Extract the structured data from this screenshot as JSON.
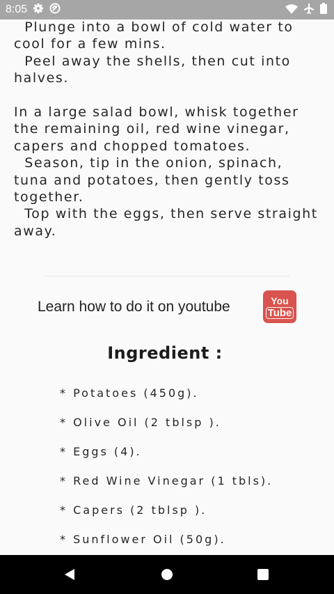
{
  "status_bar": {
    "time": "8:05",
    "icons_left": [
      "gear-icon",
      "sync-icon"
    ],
    "icons_right": [
      "wifi-icon",
      "airplane-icon",
      "battery-icon"
    ],
    "background": "#a6a6a6"
  },
  "instructions": {
    "lines_block_1": "  Plunge into a bowl of cold water to cool for a few mins.\n  Peel away the shells, then cut into halves.",
    "lines_block_2": "In a large salad bowl, whisk together the remaining oil, red wine vinegar, capers and chopped tomatoes.\n  Season, tip in the onion, spinach, tuna and potatoes, then gently toss together.\n  Top with the eggs, then serve straight away."
  },
  "youtube": {
    "label": "Learn how to do it on youtube",
    "logo_top": "You",
    "logo_bottom": "Tube",
    "color": "#d9534f"
  },
  "ingredients": {
    "title": "Ingredient :",
    "items": [
      "* Potatoes (450g).",
      "* Olive Oil (2 tblsp ).",
      "* Eggs (4).",
      "* Red Wine Vinegar (1 tbls).",
      "* Capers (2 tblsp ).",
      "* Sunflower Oil (50g)."
    ]
  },
  "nav_bar": {
    "buttons": [
      "back-icon",
      "home-icon",
      "recents-icon"
    ]
  }
}
